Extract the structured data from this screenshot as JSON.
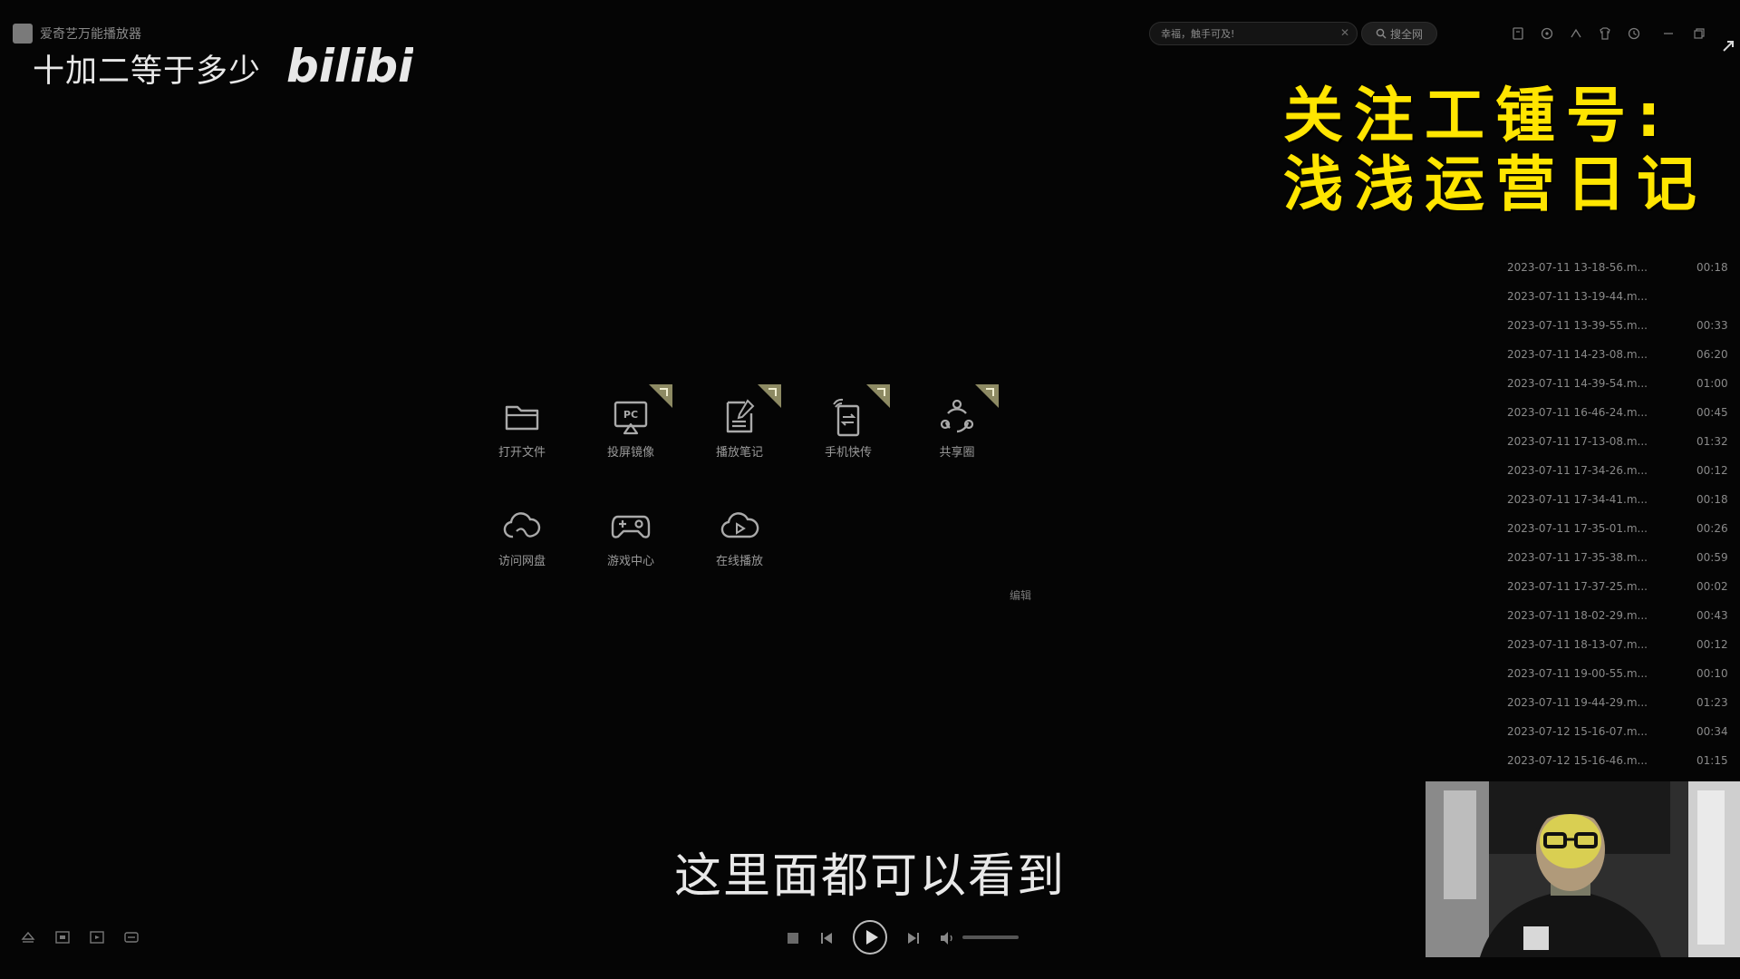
{
  "window": {
    "app_name": "爱奇艺万能播放器",
    "search_placeholder": "幸福，触手可及!",
    "search_button": "搜全网"
  },
  "overlay": {
    "question": "十加二等于多少",
    "logo": "bilibili",
    "promo_line1": "关注工锺号:",
    "promo_line2": "浅浅运营日记",
    "subtitle": "这里面都可以看到"
  },
  "home": {
    "tiles": [
      {
        "label": "打开文件",
        "icon": "folder-icon",
        "badge": false
      },
      {
        "label": "投屏镜像",
        "icon": "pc-cast-icon",
        "badge": true
      },
      {
        "label": "播放笔记",
        "icon": "note-icon",
        "badge": true
      },
      {
        "label": "手机快传",
        "icon": "phone-transfer-icon",
        "badge": true
      },
      {
        "label": "共享圈",
        "icon": "share-circle-icon",
        "badge": true
      },
      {
        "label": "访问网盘",
        "icon": "cloud-drive-icon",
        "badge": false
      },
      {
        "label": "游戏中心",
        "icon": "gamepad-icon",
        "badge": false
      },
      {
        "label": "在线播放",
        "icon": "cloud-play-icon",
        "badge": false
      }
    ],
    "edit_label": "编辑"
  },
  "playlist": [
    {
      "name": "2023-07-11 13-18-56.m...",
      "duration": "00:18"
    },
    {
      "name": "2023-07-11 13-19-44.m...",
      "duration": ""
    },
    {
      "name": "2023-07-11 13-39-55.m...",
      "duration": "00:33"
    },
    {
      "name": "2023-07-11 14-23-08.m...",
      "duration": "06:20"
    },
    {
      "name": "2023-07-11 14-39-54.m...",
      "duration": "01:00"
    },
    {
      "name": "2023-07-11 16-46-24.m...",
      "duration": "00:45"
    },
    {
      "name": "2023-07-11 17-13-08.m...",
      "duration": "01:32"
    },
    {
      "name": "2023-07-11 17-34-26.m...",
      "duration": "00:12"
    },
    {
      "name": "2023-07-11 17-34-41.m...",
      "duration": "00:18"
    },
    {
      "name": "2023-07-11 17-35-01.m...",
      "duration": "00:26"
    },
    {
      "name": "2023-07-11 17-35-38.m...",
      "duration": "00:59"
    },
    {
      "name": "2023-07-11 17-37-25.m...",
      "duration": "00:02"
    },
    {
      "name": "2023-07-11 18-02-29.m...",
      "duration": "00:43"
    },
    {
      "name": "2023-07-11 18-13-07.m...",
      "duration": "00:12"
    },
    {
      "name": "2023-07-11 19-00-55.m...",
      "duration": "00:10"
    },
    {
      "name": "2023-07-11 19-44-29.m...",
      "duration": "01:23"
    },
    {
      "name": "2023-07-12 15-16-07.m...",
      "duration": "00:34"
    },
    {
      "name": "2023-07-12 15-16-46.m...",
      "duration": "01:15"
    }
  ],
  "player": {
    "volume_fraction": 0.0
  },
  "colors": {
    "background": "#050505",
    "promo_text": "#ffe500",
    "ui_text": "#8a8a8a"
  }
}
